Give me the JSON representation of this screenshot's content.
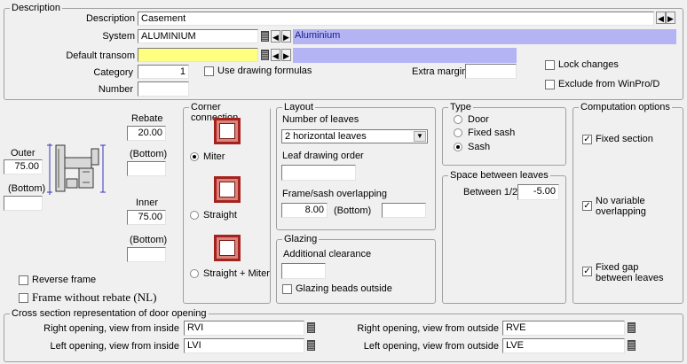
{
  "description": {
    "legend": "Description",
    "description_label": "Description",
    "description_value": "Casement",
    "system_label": "System",
    "system_value": "ALUMINIUM",
    "system_name": "Aluminium",
    "transom_label": "Default transom",
    "transom_value": "",
    "category_label": "Category",
    "category_value": "1",
    "use_formulas_label": "Use drawing formulas",
    "extra_margin_label": "Extra margin",
    "extra_margin_value": "",
    "number_label": "Number",
    "number_value": "",
    "lock_changes_label": "Lock changes",
    "exclude_label": "Exclude from WinPro/D"
  },
  "profile": {
    "rebate_label": "Rebate",
    "rebate_value": "20.00",
    "rebate_bottom_label": "(Bottom)",
    "rebate_bottom_value": "",
    "outer_label": "Outer",
    "outer_value": "75.00",
    "outer_bottom_label": "(Bottom)",
    "outer_bottom_value": "",
    "inner_label": "Inner",
    "inner_value": "75.00",
    "inner_bottom_label": "(Bottom)",
    "inner_bottom_value": "",
    "reverse_frame_label": "Reverse frame",
    "frame_without_rebate_label": "Frame without rebate (NL)"
  },
  "corner": {
    "legend": "Corner connection",
    "miter_label": "Miter",
    "straight_label": "Straight",
    "straight_miter_label": "Straight + Miter",
    "selected": "miter"
  },
  "layout": {
    "legend": "Layout",
    "leaves_label": "Number of leaves",
    "leaves_value": "2 horizontal leaves",
    "leaf_order_label": "Leaf drawing order",
    "leaf_order_value": "",
    "overlap_label": "Frame/sash overlapping",
    "overlap_value": "8.00",
    "overlap_bottom_label": "(Bottom)",
    "overlap_bottom_value": ""
  },
  "glazing": {
    "legend": "Glazing",
    "clearance_label": "Additional clearance",
    "clearance_value": "",
    "beads_outside_label": "Glazing beads outside"
  },
  "type": {
    "legend": "Type",
    "door_label": "Door",
    "fixed_sash_label": "Fixed sash",
    "sash_label": "Sash",
    "selected": "sash"
  },
  "space": {
    "legend": "Space between leaves",
    "between_label": "Between 1/2",
    "between_value": "-5.00"
  },
  "computation": {
    "legend": "Computation options",
    "fixed_section_label": "Fixed section",
    "no_variable_overlap_label1": "No variable",
    "no_variable_overlap_label2": "overlapping",
    "fixed_gap_label1": "Fixed gap",
    "fixed_gap_label2": "between leaves"
  },
  "cross_section": {
    "legend": "Cross section representation of door opening",
    "right_inside_label": "Right opening, view from inside",
    "right_inside_value": "RVI",
    "left_inside_label": "Left opening, view from inside",
    "left_inside_value": "LVI",
    "right_outside_label": "Right opening, view from outside",
    "right_outside_value": "RVE",
    "left_outside_label": "Left opening, view from outside",
    "left_outside_value": "LVE"
  },
  "colors": {
    "background": "#f0f0f0",
    "transom_yellow": "#ffff80",
    "system_lavender": "#b4b4f5",
    "corner_tile_red": "#a5231e"
  }
}
